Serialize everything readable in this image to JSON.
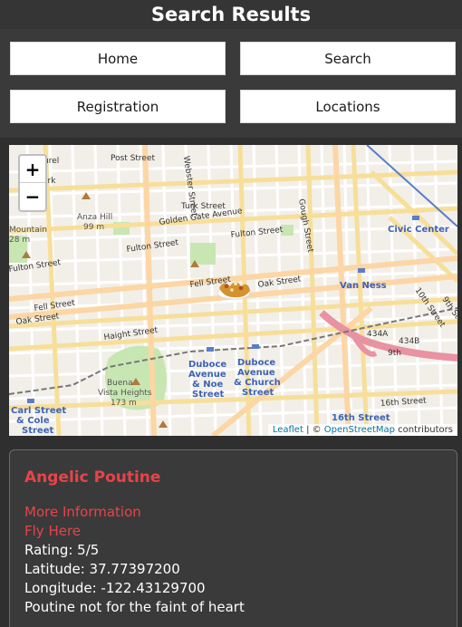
{
  "header": {
    "title": "Search Results"
  },
  "nav": {
    "items": [
      {
        "label": "Home"
      },
      {
        "label": "Search"
      },
      {
        "label": "Registration"
      },
      {
        "label": "Locations"
      }
    ]
  },
  "map": {
    "zoom_in_label": "+",
    "zoom_out_label": "−",
    "attribution": {
      "leaflet": "Leaflet",
      "separator": " | © ",
      "osm": "OpenStreetMap",
      "suffix": " contributors"
    },
    "labels": {
      "post_street": "Post Street",
      "webster_street": "Webster Street",
      "turk_street": "Turk Street",
      "golden_gate": "Golden Gate Avenue",
      "anza_hill": "Anza Hill",
      "anza_hill_elev": "99 m",
      "fulton_street_1": "Fulton Street",
      "fulton_street_2": "Fulton Street",
      "fulton_street_3": "Fulton Street",
      "gough_street": "Gough Street",
      "civic_center": "Civic Center",
      "fell_street_1": "Fell Street",
      "fell_street_2": "Fell Street",
      "oak_street_1": "Oak Street",
      "oak_street_2": "Oak Street",
      "van_ness": "Van Ness",
      "tenth_street": "10th Street",
      "ninth_street": "9th St",
      "haight_street": "Haight Street",
      "duboce_noe_1": "Duboce",
      "duboce_noe_2": "Avenue",
      "duboce_noe_3": "& Noe",
      "duboce_noe_4": "Street",
      "duboce_church_1": "Duboce",
      "duboce_church_2": "Avenue",
      "duboce_church_3": "& Church",
      "duboce_church_4": "Street",
      "buena_vista_1": "Buena",
      "buena_vista_2": "Vista Heights",
      "buena_vista_elev": "173 m",
      "carl_cole_1": "Carl Street",
      "carl_cole_2": "& Cole",
      "carl_cole_3": "Street",
      "sixteenth_street": "16th Street",
      "sixteenth_street_2": "16th Street",
      "mountain": "Mountain",
      "mountain_elev": "28 m",
      "laurel": "urel",
      "hwy_434a": "434A",
      "hwy_434b": "434B",
      "hwy_9th": "9th",
      "irk": "irk"
    }
  },
  "result": {
    "name": "Angelic Poutine",
    "more_info": "More Information",
    "fly_here": "Fly Here",
    "rating": "Rating: 5/5",
    "latitude": "Latitude: 37.77397200",
    "longitude": "Longitude: -122.43129700",
    "description": "Poutine not for the faint of heart"
  },
  "colors": {
    "accent": "#e8434a",
    "background": "#2f2f2f",
    "panel": "#3a3a3a"
  }
}
